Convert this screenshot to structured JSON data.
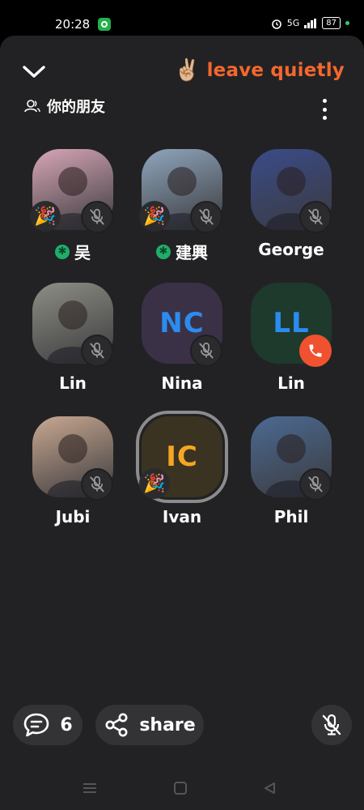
{
  "status_bar": {
    "time": "20:28",
    "network": "5G",
    "battery": "87"
  },
  "header": {
    "leave_emoji": "✌🏼",
    "leave_label": "leave quietly",
    "friends_label": "你的朋友"
  },
  "members": [
    {
      "name": "吴",
      "initials": "",
      "avatar": "photo",
      "avatar_color": "#d7a6b7",
      "online": true,
      "party": true,
      "muted": true
    },
    {
      "name": "建興",
      "initials": "",
      "avatar": "photo",
      "avatar_color": "#8fa6bd",
      "online": true,
      "party": true,
      "muted": true
    },
    {
      "name": "George",
      "initials": "",
      "avatar": "photo",
      "avatar_color": "#3a4b8a",
      "online": false,
      "party": false,
      "muted": true
    },
    {
      "name": "Lin",
      "initials": "",
      "avatar": "photo",
      "avatar_color": "#8e8e86",
      "online": false,
      "party": false,
      "muted": true
    },
    {
      "name": "Nina",
      "initials": "NC",
      "avatar": "initials",
      "avatar_color": "#3a3147",
      "text_color": "#2b8cf0",
      "online": false,
      "party": false,
      "muted": true
    },
    {
      "name": "Lin",
      "initials": "LL",
      "avatar": "initials",
      "avatar_color": "#1d3a2c",
      "text_color": "#2b8cf0",
      "online": false,
      "party": false,
      "muted": false,
      "calling": true
    },
    {
      "name": "Jubi",
      "initials": "",
      "avatar": "photo",
      "avatar_color": "#c9a892",
      "online": false,
      "party": false,
      "muted": true
    },
    {
      "name": "Ivan",
      "initials": "IC",
      "avatar": "initials",
      "avatar_color": "#3b3322",
      "text_color": "#f5a623",
      "online": false,
      "party": true,
      "muted": false,
      "speaking": true
    },
    {
      "name": "Phil",
      "initials": "",
      "avatar": "photo",
      "avatar_color": "#4c6a93",
      "online": false,
      "party": false,
      "muted": true
    }
  ],
  "bottom_bar": {
    "chat_count": "6",
    "share_label": "share"
  },
  "colors": {
    "accent": "#f4672e",
    "panel": "#222224",
    "button": "#333336",
    "online": "#1fae6a"
  }
}
